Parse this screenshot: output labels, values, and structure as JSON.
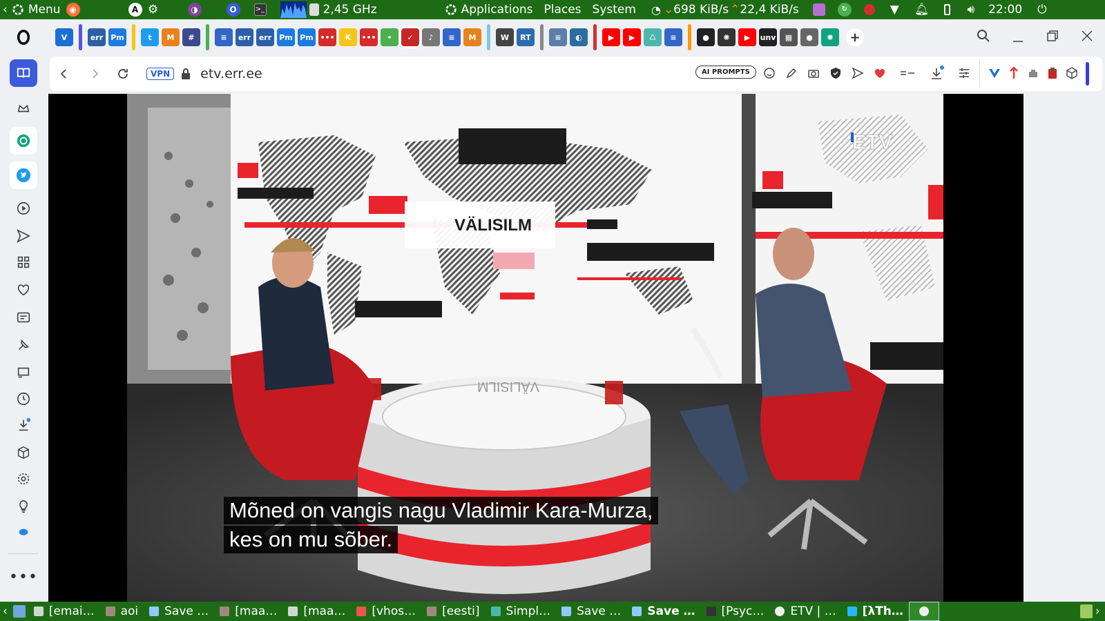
{
  "system_panel": {
    "menu_label": "Menu",
    "cpu_freq": "2,45 GHz",
    "menus": [
      "Applications",
      "Places",
      "System"
    ],
    "net_down": "698 KiB/s",
    "net_up": "22,4 KiB/s",
    "clock": "22:00"
  },
  "browser": {
    "vpn_label": "VPN",
    "url": "etv.err.ee",
    "ai_prompts_label": "AI PROMPTS",
    "tabs": [
      {
        "icon": "vivaldi-tab-icon",
        "label": "V",
        "color": "#1a6fd6"
      },
      {
        "icon": "err-tab-icon",
        "label": "err",
        "color": "#2d5fa8"
      },
      {
        "icon": "pm-tab-icon",
        "label": "Pm",
        "color": "#1b7be0"
      },
      {
        "icon": "twitter-tab-icon",
        "label": "t",
        "color": "#1d9bf0"
      },
      {
        "icon": "metamask-tab-icon",
        "label": "M",
        "color": "#e8821e"
      },
      {
        "icon": "grid-tab-icon",
        "label": "#",
        "color": "#3b4a8e"
      },
      {
        "icon": "mail-tab-icon",
        "label": "≡",
        "color": "#3266c9"
      },
      {
        "icon": "err-tab-icon",
        "label": "err",
        "color": "#2d5fa8"
      },
      {
        "icon": "err-tab-icon",
        "label": "err",
        "color": "#2d5fa8"
      },
      {
        "icon": "pm-tab-icon",
        "label": "Pm",
        "color": "#1b7be0"
      },
      {
        "icon": "pm-tab-icon",
        "label": "Pm",
        "color": "#1b7be0"
      },
      {
        "icon": "dots-tab-icon",
        "label": "•••",
        "color": "#d52b2b"
      },
      {
        "icon": "k-tab-icon",
        "label": "K",
        "color": "#f5c518"
      },
      {
        "icon": "dots-tab-icon",
        "label": "•••",
        "color": "#d52b2b"
      },
      {
        "icon": "green-tab-icon",
        "label": "•",
        "color": "#4caf50"
      },
      {
        "icon": "active-tab-icon",
        "label": "✓",
        "color": "#c62828"
      },
      {
        "icon": "mute-tab-icon",
        "label": "♪",
        "color": "#777"
      },
      {
        "icon": "mail-tab-icon",
        "label": "≡",
        "color": "#3266c9"
      },
      {
        "icon": "metamask-tab-icon",
        "label": "M",
        "color": "#e8821e"
      },
      {
        "icon": "wiki-tab-icon",
        "label": "W",
        "color": "#444"
      },
      {
        "icon": "rt-tab-icon",
        "label": "RT",
        "color": "#2b6cb0"
      },
      {
        "icon": "doc-tab-icon",
        "label": "≡",
        "color": "#5b7fa8"
      },
      {
        "icon": "globe-tab-icon",
        "label": "◐",
        "color": "#2d6c9f"
      },
      {
        "icon": "youtube-tab-icon",
        "label": "▶",
        "color": "#ff0000"
      },
      {
        "icon": "youtube-tab-icon",
        "label": "▶",
        "color": "#ff0000"
      },
      {
        "icon": "recycle-tab-icon",
        "label": "♺",
        "color": "#4db6ac"
      },
      {
        "icon": "mail-tab-icon",
        "label": "≡",
        "color": "#3266c9"
      },
      {
        "icon": "circle-tab-icon",
        "label": "●",
        "color": "#222"
      },
      {
        "icon": "chatgpt-tab-icon",
        "label": "✺",
        "color": "#333"
      },
      {
        "icon": "youtube-tab-icon",
        "label": "▶",
        "color": "#ff0000"
      },
      {
        "icon": "unv-tab-icon",
        "label": "unv",
        "color": "#222"
      },
      {
        "icon": "apps-tab-icon",
        "label": "▦",
        "color": "#555"
      },
      {
        "icon": "globe-tab-icon",
        "label": "●",
        "color": "#666"
      },
      {
        "icon": "chatgpt-tab-icon",
        "label": "✺",
        "color": "#10a37f"
      }
    ]
  },
  "video": {
    "show_title": "VÄLISILM",
    "channel_logo": "ETV",
    "subtitle_line1": "Mõned on vangis nagu Vladimir Kara-Murza,",
    "subtitle_line2": "kes on mu sõber."
  },
  "taskbar": {
    "items": [
      {
        "label": "[emai…",
        "icon": "terminal-icon",
        "active": false,
        "bold": false
      },
      {
        "label": "aoi",
        "icon": "folder-icon",
        "active": false,
        "bold": false
      },
      {
        "label": "Save …",
        "icon": "save-dialog-icon",
        "active": false,
        "bold": false
      },
      {
        "label": "[maa…",
        "icon": "folder-icon",
        "active": false,
        "bold": false
      },
      {
        "label": "[maa…",
        "icon": "terminal-icon",
        "active": false,
        "bold": false
      },
      {
        "label": "[vhos…",
        "icon": "editor-icon",
        "active": false,
        "bold": false
      },
      {
        "label": "[eesti]",
        "icon": "folder-icon",
        "active": false,
        "bold": false
      },
      {
        "label": "Simpl…",
        "icon": "app-icon",
        "active": false,
        "bold": false
      },
      {
        "label": "Save …",
        "icon": "save-dialog-icon",
        "active": false,
        "bold": false
      },
      {
        "label": "Save …",
        "icon": "save-dialog-icon",
        "active": false,
        "bold": true
      },
      {
        "label": "[Psyc…",
        "icon": "phone-icon",
        "active": false,
        "bold": false
      },
      {
        "label": "ETV | …",
        "icon": "opera-icon",
        "active": false,
        "bold": false
      },
      {
        "label": "[λTh…",
        "icon": "telegram-icon",
        "active": false,
        "bold": true
      },
      {
        "label": "",
        "icon": "opera-icon",
        "active": true,
        "bold": false
      }
    ]
  },
  "colors": {
    "panel_green": "#1e6b16",
    "opera_red": "#ff1b2d",
    "accent_blue": "#2b5bd7",
    "studio_red": "#e8242c"
  }
}
